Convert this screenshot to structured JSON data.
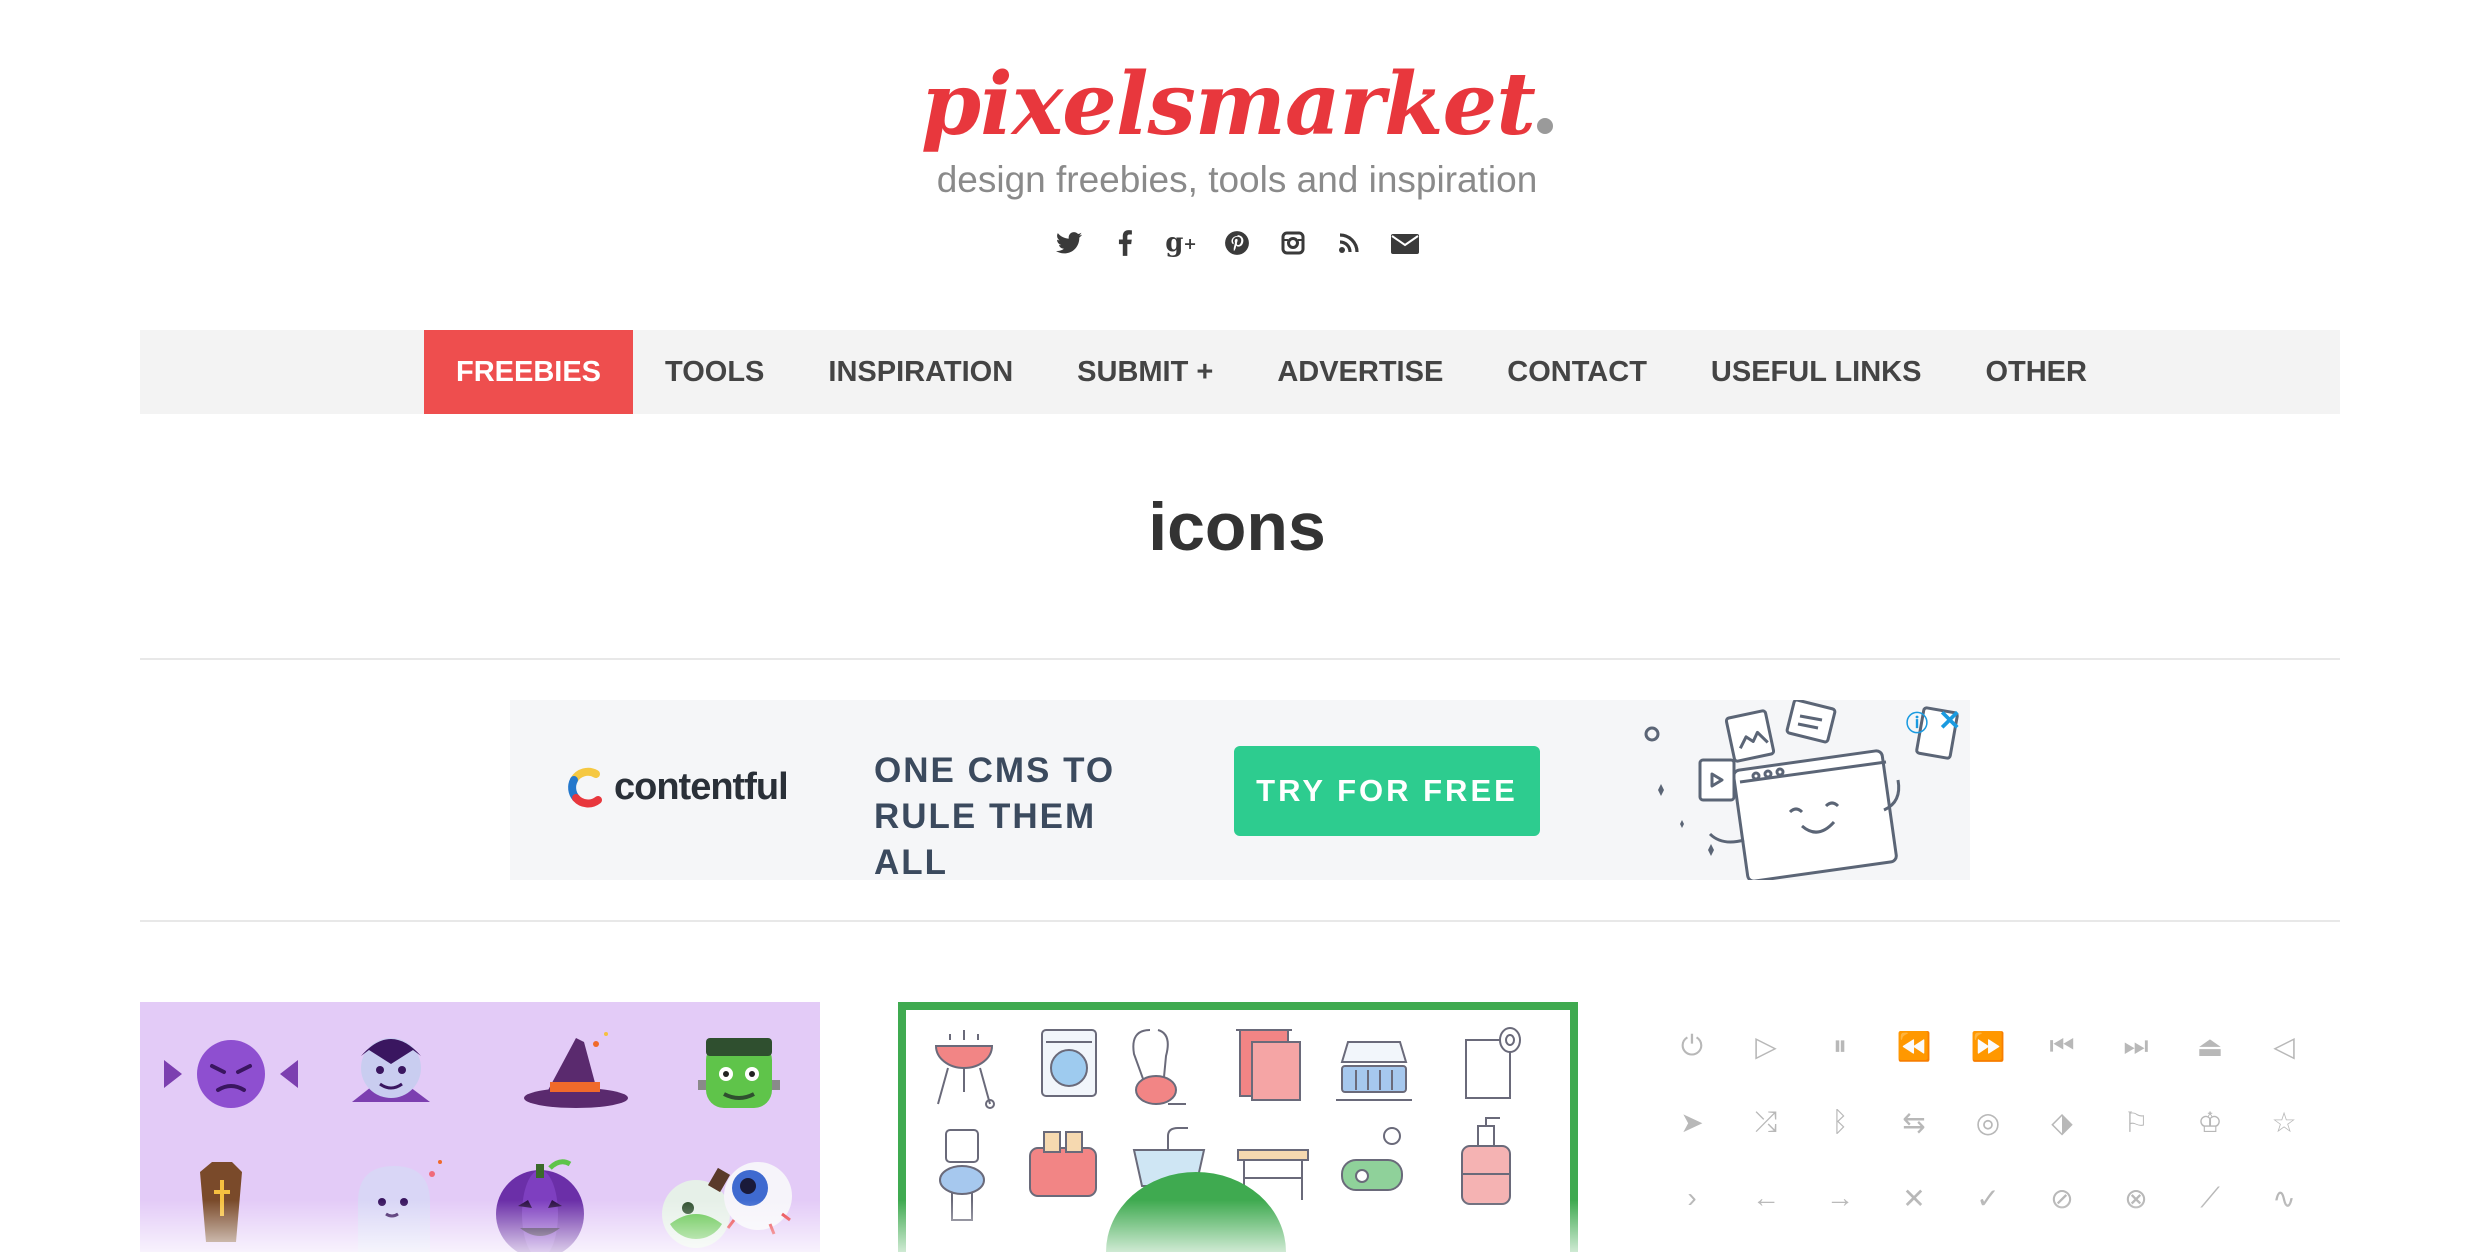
{
  "site": {
    "logo": "pixelsmarket",
    "tagline": "design freebies, tools and inspiration",
    "social": [
      "twitter-icon",
      "facebook-icon",
      "google-plus-icon",
      "pinterest-icon",
      "instagram-icon",
      "rss-icon",
      "email-icon"
    ],
    "brand_color": "#e8373d"
  },
  "nav": {
    "items": [
      {
        "label": "FREEBIES",
        "active": true
      },
      {
        "label": "TOOLS"
      },
      {
        "label": "INSPIRATION"
      },
      {
        "label": "SUBMIT +"
      },
      {
        "label": "ADVERTISE"
      },
      {
        "label": "CONTACT"
      },
      {
        "label": "USEFUL LINKS"
      },
      {
        "label": "OTHER"
      }
    ],
    "active_color": "#ee4e4e"
  },
  "page": {
    "title": "icons"
  },
  "ad": {
    "brand": "contentful",
    "headline_line1": "ONE CMS TO",
    "headline_line2": "RULE THEM ALL",
    "cta": "TRY FOR FREE",
    "cta_color": "#2dcc8f"
  },
  "cards": [
    {
      "theme": "halloween icons",
      "background": "#e3cbf7"
    },
    {
      "theme": "household icons",
      "border_color": "#3faa50"
    },
    {
      "theme": "line icons"
    }
  ]
}
